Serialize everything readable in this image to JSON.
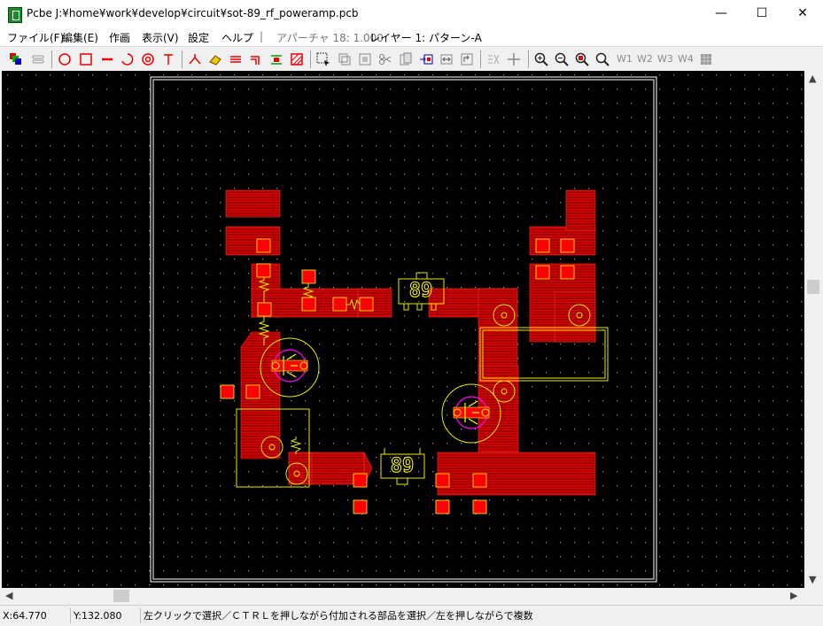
{
  "window": {
    "title": "Pcbe J:¥home¥work¥develop¥circuit¥sot-89_rf_poweramp.pcb",
    "minimize_glyph": "—",
    "maximize_glyph": "☐",
    "close_glyph": "✕"
  },
  "menu": {
    "items": [
      "ファイル(F)",
      "編集(E)",
      "作画",
      "表示(V)",
      "設定",
      "ヘルプ"
    ],
    "separator": "|",
    "aperture": "アパーチャ 18: 1.000",
    "layer": "レイヤー 1: パターン-A"
  },
  "toolbar": {
    "icons": [
      "layers-icon",
      "line-cap-icon",
      "circle-icon",
      "rectangle-icon",
      "line-icon",
      "arc-icon",
      "donut-icon",
      "text-icon",
      "junction-icon",
      "eraser-icon",
      "bus-icon",
      "corner-icon",
      "pad-row-icon",
      "hatch-icon",
      "select-icon",
      "copy-icon",
      "cut-icon",
      "paste-icon",
      "move-icon",
      "flip-icon",
      "rotate-icon",
      "grid-icon",
      "crosshair-icon",
      "zoom-in-icon",
      "zoom-out-icon",
      "zoom-fit-icon",
      "zoom-icon"
    ],
    "w1": "W1",
    "w2": "W2",
    "w3": "W3",
    "w4": "W4"
  },
  "canvas": {
    "component_label_1": "89",
    "component_label_2": "89"
  },
  "status": {
    "x": "X:64.770",
    "y": "Y:132.080",
    "message": "左クリックで選択／ＣＴＲＬを押しながら付加される部品を選択／左を押しながらで複数"
  },
  "colors": {
    "trace": "#e00000",
    "pad": "#ff0000",
    "silk": "#e8e800",
    "drill": "#ff00ff",
    "board_outline": "#ffffff",
    "grid_dot": "#9a9a9a"
  }
}
